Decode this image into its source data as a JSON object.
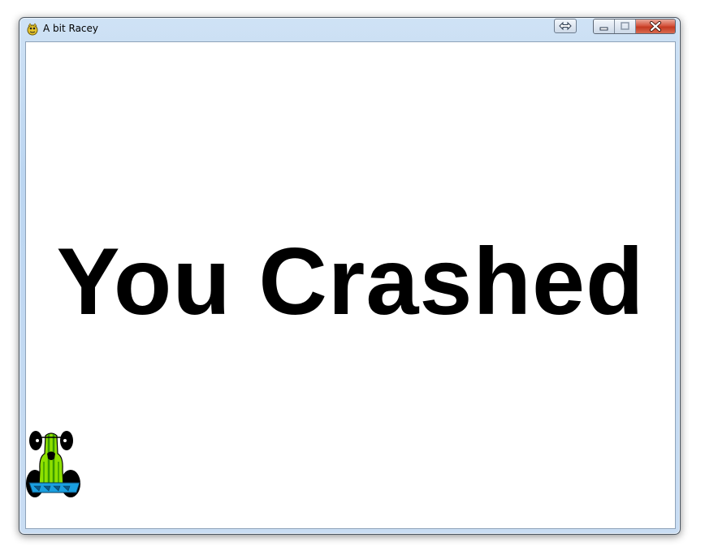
{
  "window": {
    "title": "A bit Racey",
    "app_icon": "pygame-snake-icon",
    "controls": [
      "extra-arrow-button",
      "minimize-button",
      "maximize-button",
      "close-button"
    ]
  },
  "game": {
    "message": "You Crashed",
    "background_color": "#ffffff",
    "text_color": "#000000",
    "player_car": {
      "icon": "race-car-sprite",
      "colors": {
        "body": "#8ee000",
        "stripe": "#3a9a00",
        "wheels": "#000000",
        "bumper": "#1a9fe0"
      }
    }
  }
}
